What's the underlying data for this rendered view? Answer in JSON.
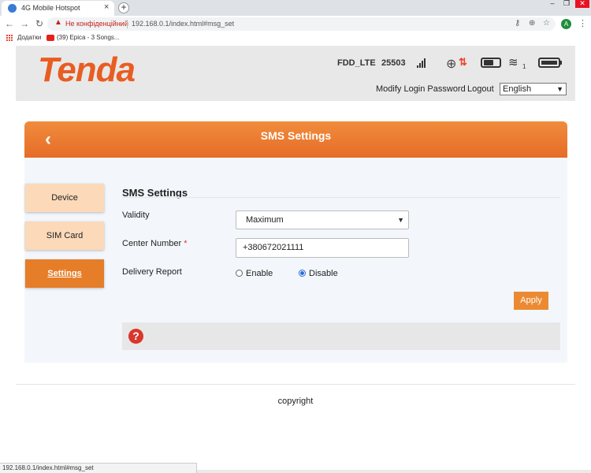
{
  "browser": {
    "tab_title": "4G Mobile Hotspot",
    "tab_close": "×",
    "new_tab": "+",
    "insecure_label": "Не конфіденційний",
    "url": "192.168.0.1/index.html#msg_set",
    "avatar_letter": "A",
    "bookmarks": [
      "Додатки",
      "(39) Epica - 3 Songs..."
    ],
    "status_url": "192.168.0.1/index.html#msg_set"
  },
  "header": {
    "logo": "Tenda",
    "network_type": "FDD_LTE",
    "network_code": "25503",
    "wifi_clients": "1",
    "modify_password": "Modify Login Password",
    "logout": "Logout",
    "language": "English"
  },
  "page": {
    "banner_title": "SMS Settings",
    "nav": [
      "Device",
      "SIM Card",
      "Settings"
    ],
    "active_nav": "Settings",
    "form_title": "SMS Settings",
    "validity_label": "Validity",
    "validity_value": "Maximum",
    "center_number_label": "Center Number",
    "required_mark": "*",
    "center_number_value": "+380672021111",
    "delivery_report_label": "Delivery Report",
    "delivery_options": [
      "Enable",
      "Disable"
    ],
    "delivery_selected": "Disable",
    "apply": "Apply",
    "help_symbol": "?",
    "copyright": "copyright"
  },
  "colors": {
    "accent": "#e67d28",
    "brand": "#e85d22",
    "nav_inactive": "#fbd9b9"
  }
}
